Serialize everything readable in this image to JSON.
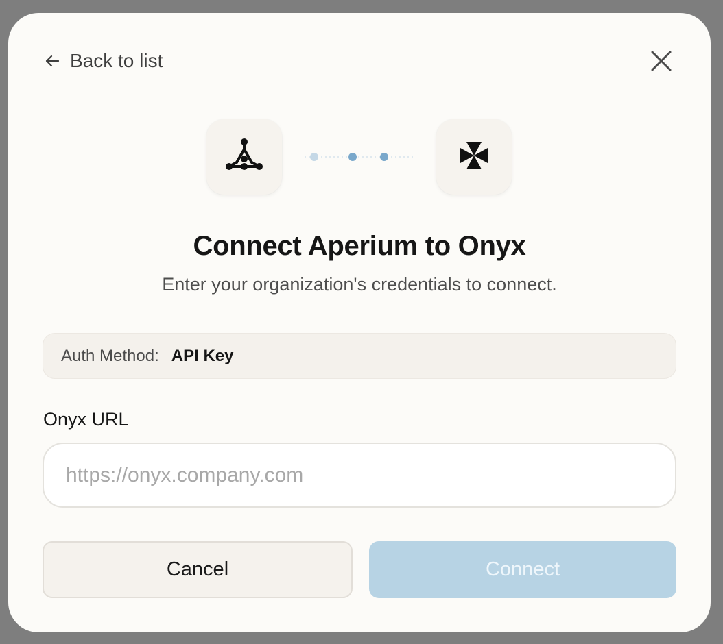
{
  "nav": {
    "back_label": "Back to list"
  },
  "logos": {
    "source_icon": "aperium-logo-icon",
    "target_icon": "onyx-logo-icon"
  },
  "dialog": {
    "title": "Connect Aperium to Onyx",
    "subtitle": "Enter your organization's credentials to connect."
  },
  "auth": {
    "label": "Auth Method:",
    "value": "API Key"
  },
  "url_field": {
    "label": "Onyx URL",
    "value": "",
    "placeholder": "https://onyx.company.com"
  },
  "actions": {
    "cancel_label": "Cancel",
    "connect_label": "Connect"
  },
  "colors": {
    "accent": "#b7d3e4",
    "dot_active": "#7aa8cb",
    "dot_inactive": "#c5d8e6"
  }
}
